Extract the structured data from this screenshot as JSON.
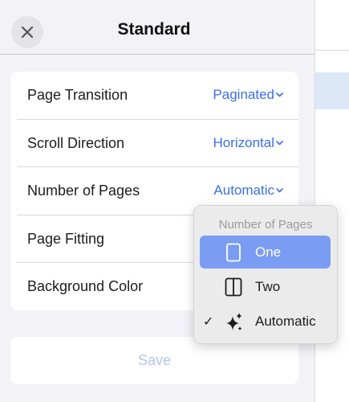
{
  "sheet": {
    "title": "Standard",
    "close_icon": "close-icon"
  },
  "settings": [
    {
      "label": "Page Transition",
      "value": "Paginated",
      "has_dropdown": true
    },
    {
      "label": "Scroll Direction",
      "value": "Horizontal",
      "has_dropdown": true
    },
    {
      "label": "Number of Pages",
      "value": "Automatic",
      "has_dropdown": true
    },
    {
      "label": "Page Fitting",
      "value": "",
      "has_dropdown": false
    },
    {
      "label": "Background Color",
      "value": "",
      "has_dropdown": false
    }
  ],
  "save_label": "Save",
  "menu": {
    "header": "Number of Pages",
    "items": [
      {
        "label": "One",
        "icon": "single-page-icon",
        "highlighted": true,
        "checked": false
      },
      {
        "label": "Two",
        "icon": "two-pages-icon",
        "highlighted": false,
        "checked": false
      },
      {
        "label": "Automatic",
        "icon": "sparkles-icon",
        "highlighted": false,
        "checked": true
      }
    ],
    "check_glyph": "✓"
  },
  "colors": {
    "accent": "#3a6ee8",
    "menu_highlight": "#7b9cf3",
    "sheet_bg": "#f2f2f7",
    "save_disabled": "#b2c6ee"
  }
}
